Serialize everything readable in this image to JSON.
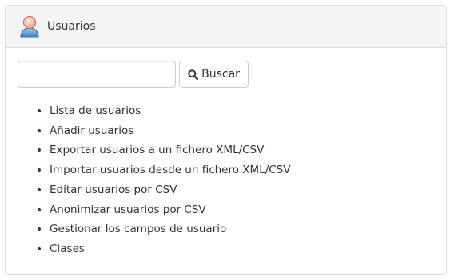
{
  "panel": {
    "title": "Usuarios",
    "icon": "user-icon"
  },
  "search": {
    "value": "",
    "placeholder": "",
    "button_label": "Buscar",
    "button_icon": "search-icon"
  },
  "links": [
    {
      "label": "Lista de usuarios"
    },
    {
      "label": "Añadir usuarios"
    },
    {
      "label": "Exportar usuarios a un fichero XML/CSV"
    },
    {
      "label": "Importar usuarios desde un fichero XML/CSV"
    },
    {
      "label": "Editar usuarios por CSV"
    },
    {
      "label": "Anonimizar usuarios por CSV"
    },
    {
      "label": "Gestionar los campos de usuario"
    },
    {
      "label": "Clases"
    }
  ]
}
